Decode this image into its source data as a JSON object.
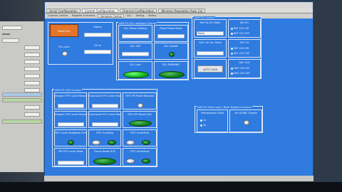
{
  "tabs": [
    {
      "label": "Serial Configuration"
    },
    {
      "label": "Control Configuration"
    },
    {
      "label": "Channel Configuration"
    },
    {
      "label": "Wireless Regulation Auto Cal"
    }
  ],
  "subtabs": [
    {
      "label": "Channel Control"
    },
    {
      "label": "Register Functions"
    },
    {
      "label": "Hardware Control"
    },
    {
      "label": "DLL"
    },
    {
      "label": "Debug"
    },
    {
      "label": "Status"
    }
  ],
  "panels": {
    "top_left": {
      "reset_label": "Reset DLL",
      "status_label": "Status",
      "pll_label": "PLL Lock",
      "clk_label": "Clk In"
    },
    "dll": {
      "title": "AD9731 DLL Interface Control",
      "dll_phase": "DLL Phase Setting",
      "fixed_phase": "Fixed Phase Mode",
      "dll_tap": "DLL TAP",
      "dll_enable": "DLL Enable",
      "dll_lock": "DLL Lock",
      "dll_running": "DLL RUNNING"
    },
    "afe": {
      "title": "AD9731 Control",
      "ref_clk": "Ref Clk Src Ratio",
      "ref_value": "Ratio",
      "ref_ch": "Ref CH",
      "opt1": "REF CLK ON",
      "opt2": "REF CLK OFF",
      "sec_ch": "SEC CH",
      "opt3": "SEC CLK ON",
      "opt4": "SEC CLK OFF",
      "dac_clk": "DAC CLK",
      "opt5": "DAC CLK ON",
      "opt6": "DAC CLK OFF",
      "cal_clk_div": "DAC Clk Div. Ratio",
      "auto_cal": "AUTO CLKS"
    },
    "fifo": {
      "title": "AD9731 FIFO Control",
      "cells": [
        {
          "label": "Integral FIFO Level Request"
        },
        {
          "label": "Fractional FIFO Level Request"
        },
        {
          "label": "FIFO SPI Reset Request"
        },
        {
          "label": "Integral FIFO Level Readback"
        },
        {
          "label": "Fractional FIFO Level Readback"
        },
        {
          "label": "FIFO SPI Reset ACK"
        },
        {
          "label": "FIFO Level Readback Enable"
        },
        {
          "label": "FIFO Overflow"
        },
        {
          "label": "FIFO Underflow"
        },
        {
          "label": "SPI FIFO Level Read"
        },
        {
          "label": "Frame Reset ACK"
        },
        {
          "label": "FIFO Underflow"
        }
      ]
    },
    "digital": {
      "title": "AD9731 Data Input / Base Digital Functions",
      "interpolation": "Interpolation Ratio",
      "opt_1x": "1x",
      "opt_2x": "2x",
      "sinc_label": "Sin X/SINC Enable"
    }
  }
}
